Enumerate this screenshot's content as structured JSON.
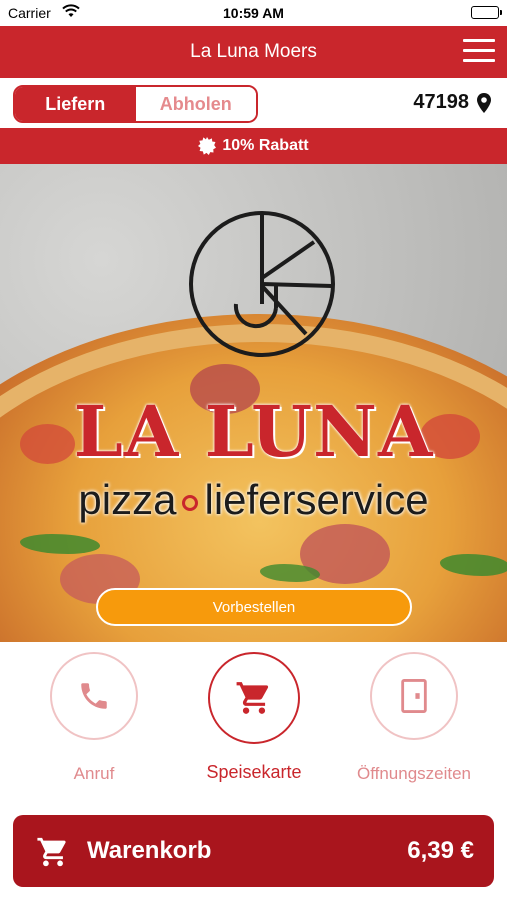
{
  "status_bar": {
    "carrier": "Carrier",
    "time": "10:59 AM"
  },
  "header": {
    "title": "La Luna Moers"
  },
  "mode": {
    "deliver_label": "Liefern",
    "pickup_label": "Abholen",
    "selected": "Liefern",
    "zip": "47198"
  },
  "discount": {
    "text": "10% Rabatt"
  },
  "hero": {
    "brand": "LA LUNA",
    "tagline_left": "pizza",
    "tagline_right": "lieferservice",
    "preorder_label": "Vorbestellen"
  },
  "actions": [
    {
      "label": "Anruf",
      "icon": "phone-icon"
    },
    {
      "label": "Speisekarte",
      "icon": "cart-icon"
    },
    {
      "label": "Öffnungszeiten",
      "icon": "door-icon"
    }
  ],
  "cart": {
    "label": "Warenkorb",
    "total": "6,39 €"
  },
  "colors": {
    "brand_red": "#c9262c",
    "dark_red": "#a9151d",
    "orange": "#f79a0c",
    "muted_red": "#e08a8d"
  }
}
